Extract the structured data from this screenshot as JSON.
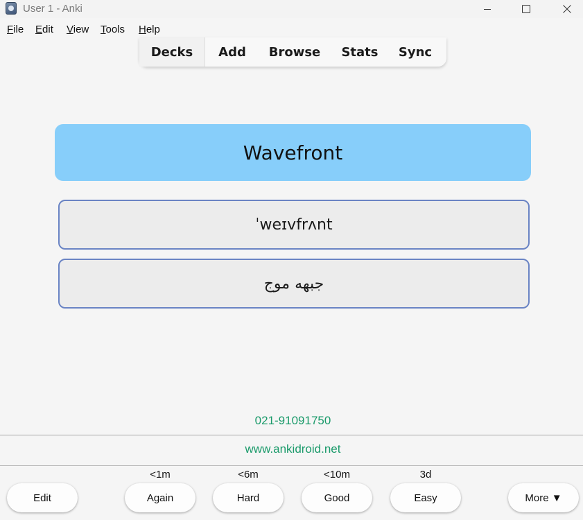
{
  "window": {
    "title": "User 1 - Anki"
  },
  "menu": {
    "items": [
      {
        "mnemonic": "F",
        "rest": "ile"
      },
      {
        "mnemonic": "E",
        "rest": "dit"
      },
      {
        "mnemonic": "V",
        "rest": "iew"
      },
      {
        "mnemonic": "T",
        "rest": "ools"
      },
      {
        "mnemonic": "H",
        "rest": "elp"
      }
    ]
  },
  "toolbar": {
    "decks": "Decks",
    "add": "Add",
    "browse": "Browse",
    "stats": "Stats",
    "sync": "Sync"
  },
  "card": {
    "word": "Wavefront",
    "phonetic": "ˈweɪvfrʌnt",
    "translation": "جبهه موج",
    "word_bg": "#87cefa",
    "border_color": "#6a84c4"
  },
  "footer": {
    "phone": "021-91091750",
    "website": "www.ankidroid.net",
    "link_color": "#1a9a6a"
  },
  "answers": {
    "edit": "Edit",
    "again": {
      "label": "Again",
      "time": "<1m"
    },
    "hard": {
      "label": "Hard",
      "time": "<6m"
    },
    "good": {
      "label": "Good",
      "time": "<10m"
    },
    "easy": {
      "label": "Easy",
      "time": "3d"
    },
    "more": "More ▼"
  },
  "icons": {
    "app": "anki-app-icon",
    "minimize": "minimize-icon",
    "maximize": "maximize-icon",
    "close": "close-icon"
  }
}
